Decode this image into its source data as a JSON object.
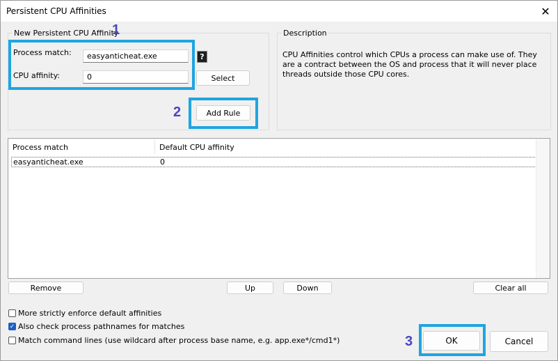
{
  "window": {
    "title": "Persistent CPU Affinities",
    "close_glyph": "✕"
  },
  "new_group": {
    "label": "New Persistent CPU Affinity",
    "process_match_label": "Process match:",
    "process_match_value": "easyanticheat.exe",
    "cpu_affinity_label": "CPU affinity:",
    "cpu_affinity_value": "0",
    "help_glyph": "?",
    "select_label": "Select",
    "add_rule_label": "Add Rule"
  },
  "description_group": {
    "label": "Description",
    "text": "CPU Affinities control which CPUs a process can make use of. They are a contract between the OS and process that it will never place threads outside those CPU cores."
  },
  "table": {
    "columns": [
      "Process match",
      "Default CPU affinity"
    ],
    "rows": [
      {
        "process": "easyanticheat.exe",
        "affinity": "0"
      }
    ]
  },
  "list_buttons": {
    "remove": "Remove",
    "up": "Up",
    "down": "Down",
    "clear_all": "Clear all"
  },
  "options": [
    {
      "label": "More strictly enforce default affinities",
      "checked": false
    },
    {
      "label": "Also check process pathnames for matches",
      "checked": true
    },
    {
      "label": "Match command lines (use wildcard after process base name, e.g. app.exe*/cmd1*)",
      "checked": false
    }
  ],
  "footer": {
    "ok": "OK",
    "cancel": "Cancel"
  },
  "annotations": {
    "n1": "1",
    "n2": "2",
    "n3": "3",
    "highlight_color": "#1ea5e0",
    "number_color": "#4a46bd"
  },
  "icons": {
    "checkmark": "✓"
  }
}
